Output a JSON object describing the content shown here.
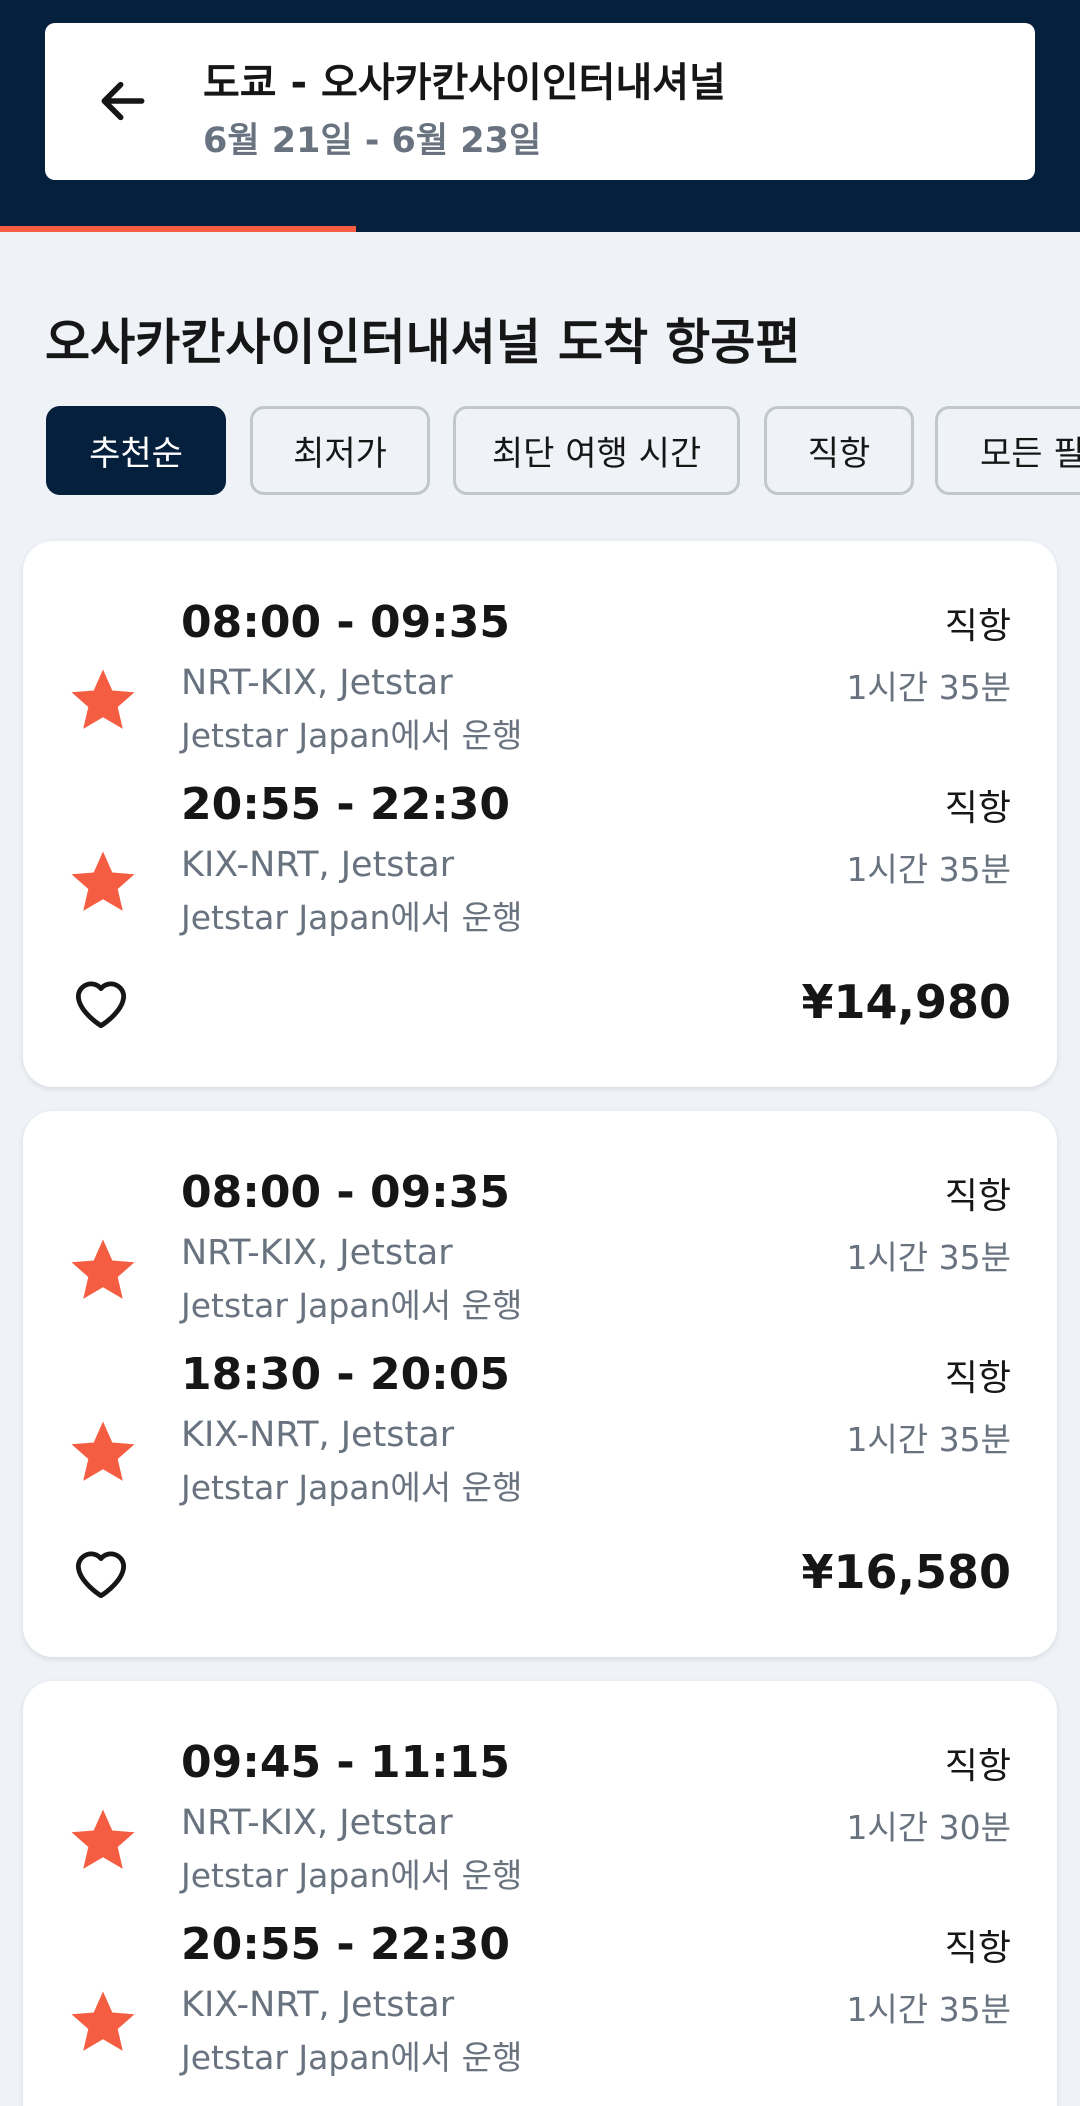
{
  "header": {
    "back_icon": "arrow-left-icon",
    "route": "도쿄 - 오사카칸사이인터내셔널",
    "dates": "6월 21일 - 6월 23일",
    "loading_progress_percent": 33,
    "accent_color": "#f55d42",
    "background_color": "#05203c"
  },
  "section_title": "오사카칸사이인터내셔널 도착 항공편",
  "filters": [
    {
      "label": "추천순",
      "active": true
    },
    {
      "label": "최저가",
      "active": false
    },
    {
      "label": "최단 여행 시간",
      "active": false
    },
    {
      "label": "직항",
      "active": false
    },
    {
      "label": "모든 필",
      "active": false
    }
  ],
  "results": [
    {
      "legs": [
        {
          "airline_logo": "jetstar-star-icon",
          "times": "08:00 - 09:35",
          "route": "NRT-KIX, Jetstar",
          "operator": "Jetstar Japan에서 운행",
          "stops": "직항",
          "duration": "1시간 35분"
        },
        {
          "airline_logo": "jetstar-star-icon",
          "times": "20:55 - 22:30",
          "route": "KIX-NRT, Jetstar",
          "operator": "Jetstar Japan에서 운행",
          "stops": "직항",
          "duration": "1시간 35분"
        }
      ],
      "favorite_icon": "heart-outline-icon",
      "price": "¥14,980"
    },
    {
      "legs": [
        {
          "airline_logo": "jetstar-star-icon",
          "times": "08:00 - 09:35",
          "route": "NRT-KIX, Jetstar",
          "operator": "Jetstar Japan에서 운행",
          "stops": "직항",
          "duration": "1시간 35분"
        },
        {
          "airline_logo": "jetstar-star-icon",
          "times": "18:30 - 20:05",
          "route": "KIX-NRT, Jetstar",
          "operator": "Jetstar Japan에서 운행",
          "stops": "직항",
          "duration": "1시간 35분"
        }
      ],
      "favorite_icon": "heart-outline-icon",
      "price": "¥16,580"
    },
    {
      "legs": [
        {
          "airline_logo": "jetstar-star-icon",
          "times": "09:45 - 11:15",
          "route": "NRT-KIX, Jetstar",
          "operator": "Jetstar Japan에서 운행",
          "stops": "직항",
          "duration": "1시간 30분"
        },
        {
          "airline_logo": "jetstar-star-icon",
          "times": "20:55 - 22:30",
          "route": "KIX-NRT, Jetstar",
          "operator": "Jetstar Japan에서 운행",
          "stops": "직항",
          "duration": "1시간 35분"
        }
      ]
    }
  ],
  "logo_color": "#f55d42"
}
